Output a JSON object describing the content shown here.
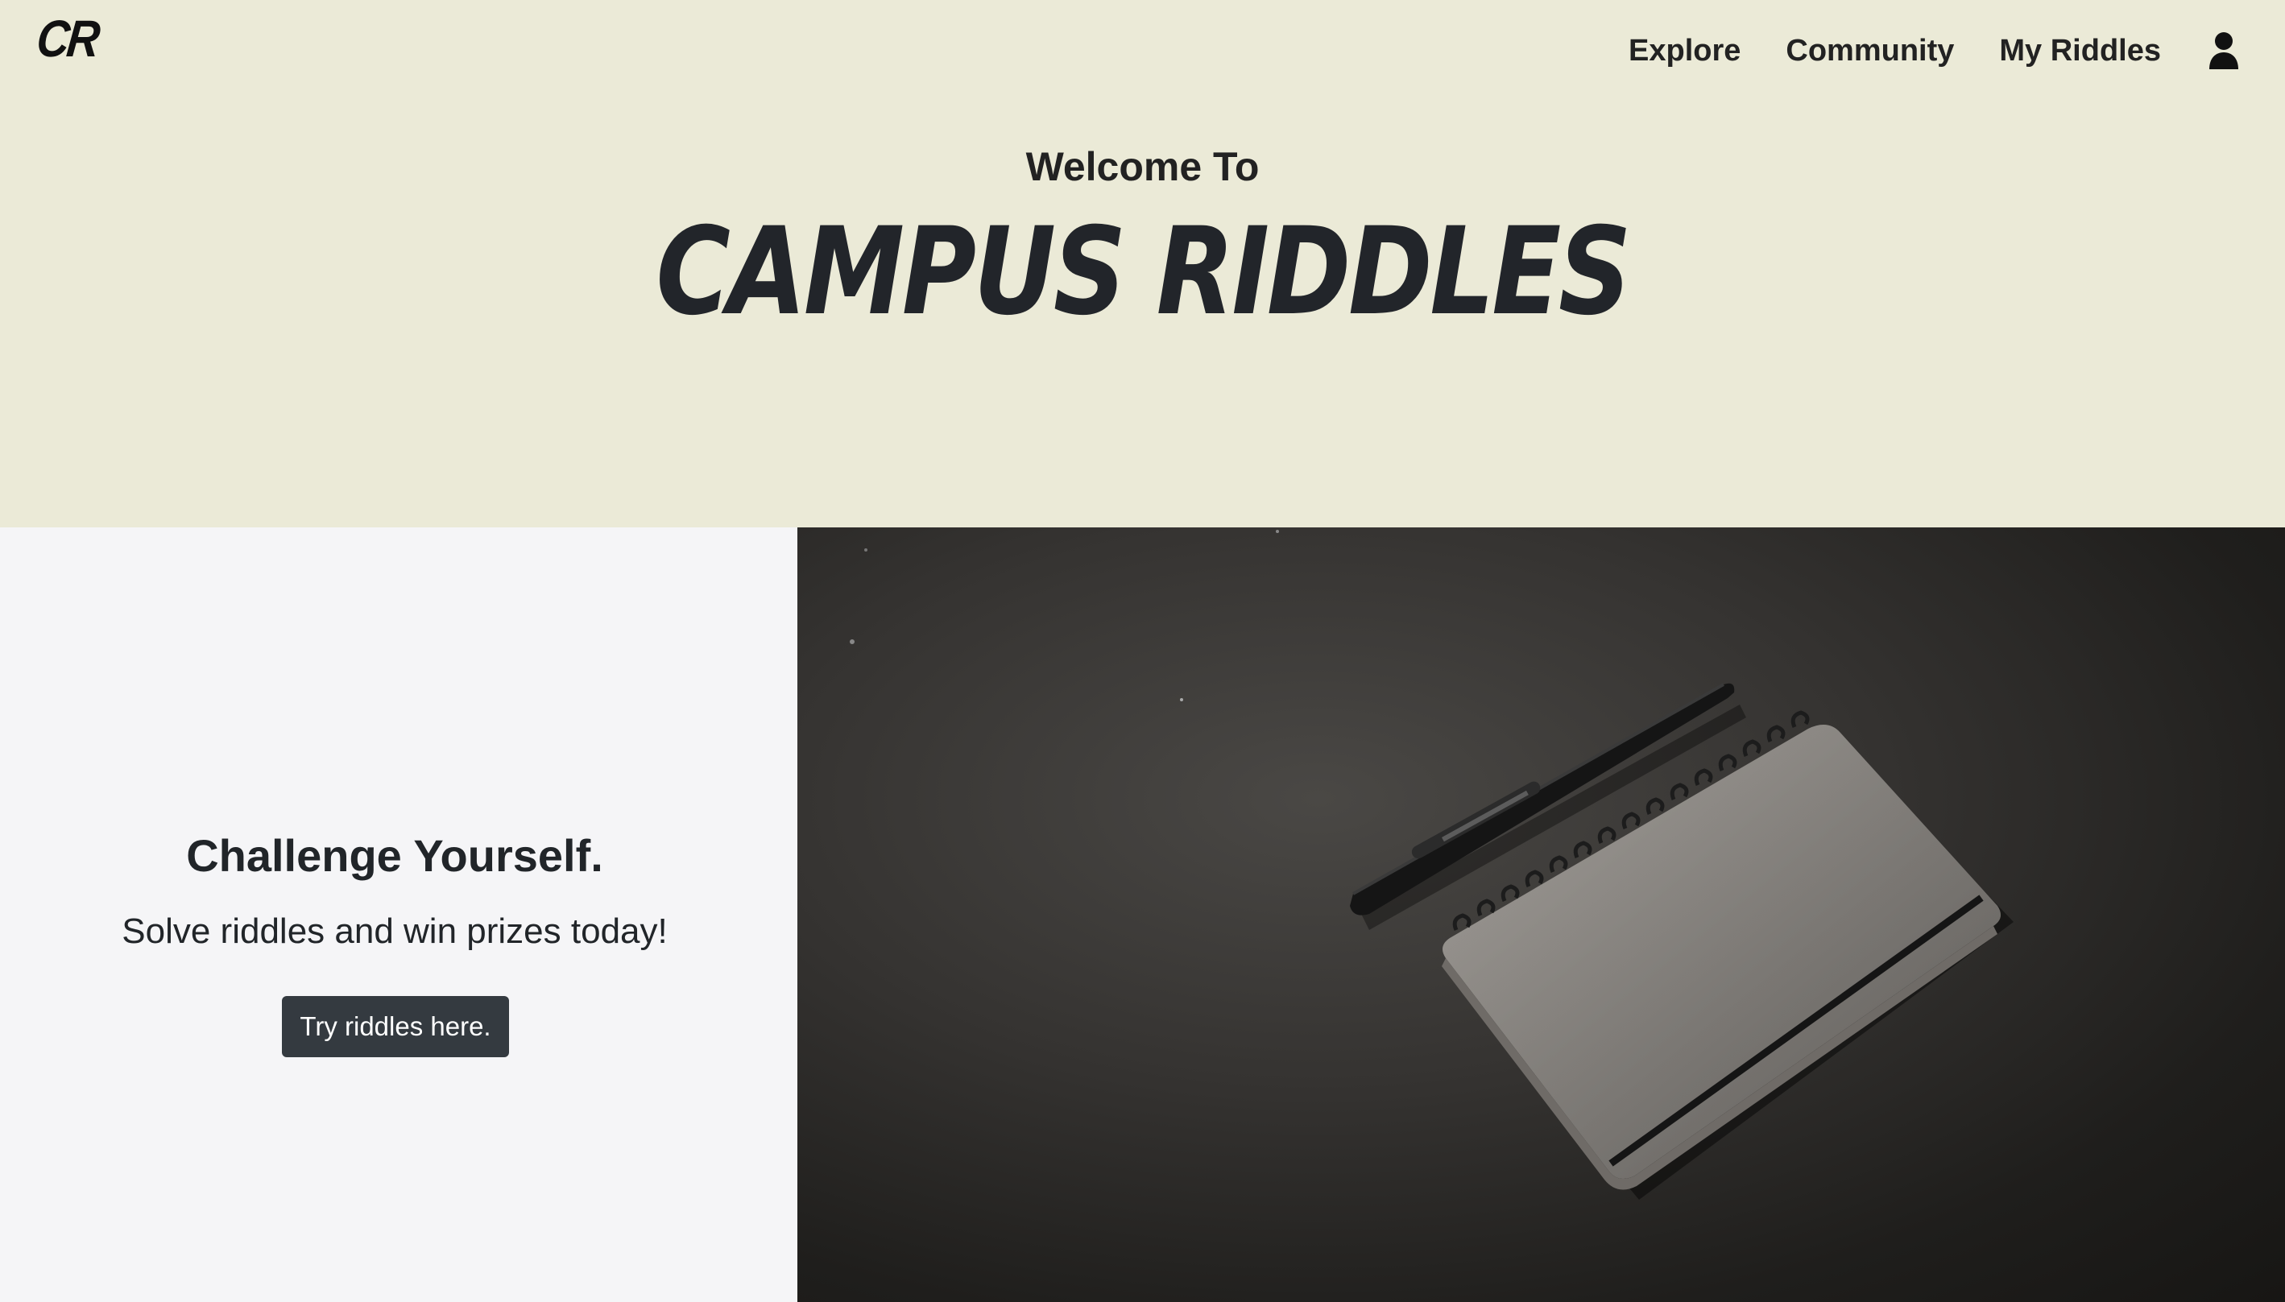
{
  "header": {
    "logo_text": "CR",
    "nav": {
      "explore": "Explore",
      "community": "Community",
      "my_riddles": "My Riddles"
    },
    "user_icon": "user-icon"
  },
  "hero": {
    "welcome": "Welcome To",
    "title": "CAMPUS RIDDLES"
  },
  "promo": {
    "heading": "Challenge Yourself.",
    "subheading": "Solve riddles and win prizes today!",
    "button_label": "Try riddles here."
  },
  "image": {
    "description_icon": "notebook-and-pen-photo"
  },
  "colors": {
    "hero_bg": "#ebead7",
    "panel_bg": "#f5f5f7",
    "button_bg": "#343a40",
    "text": "#212529"
  }
}
